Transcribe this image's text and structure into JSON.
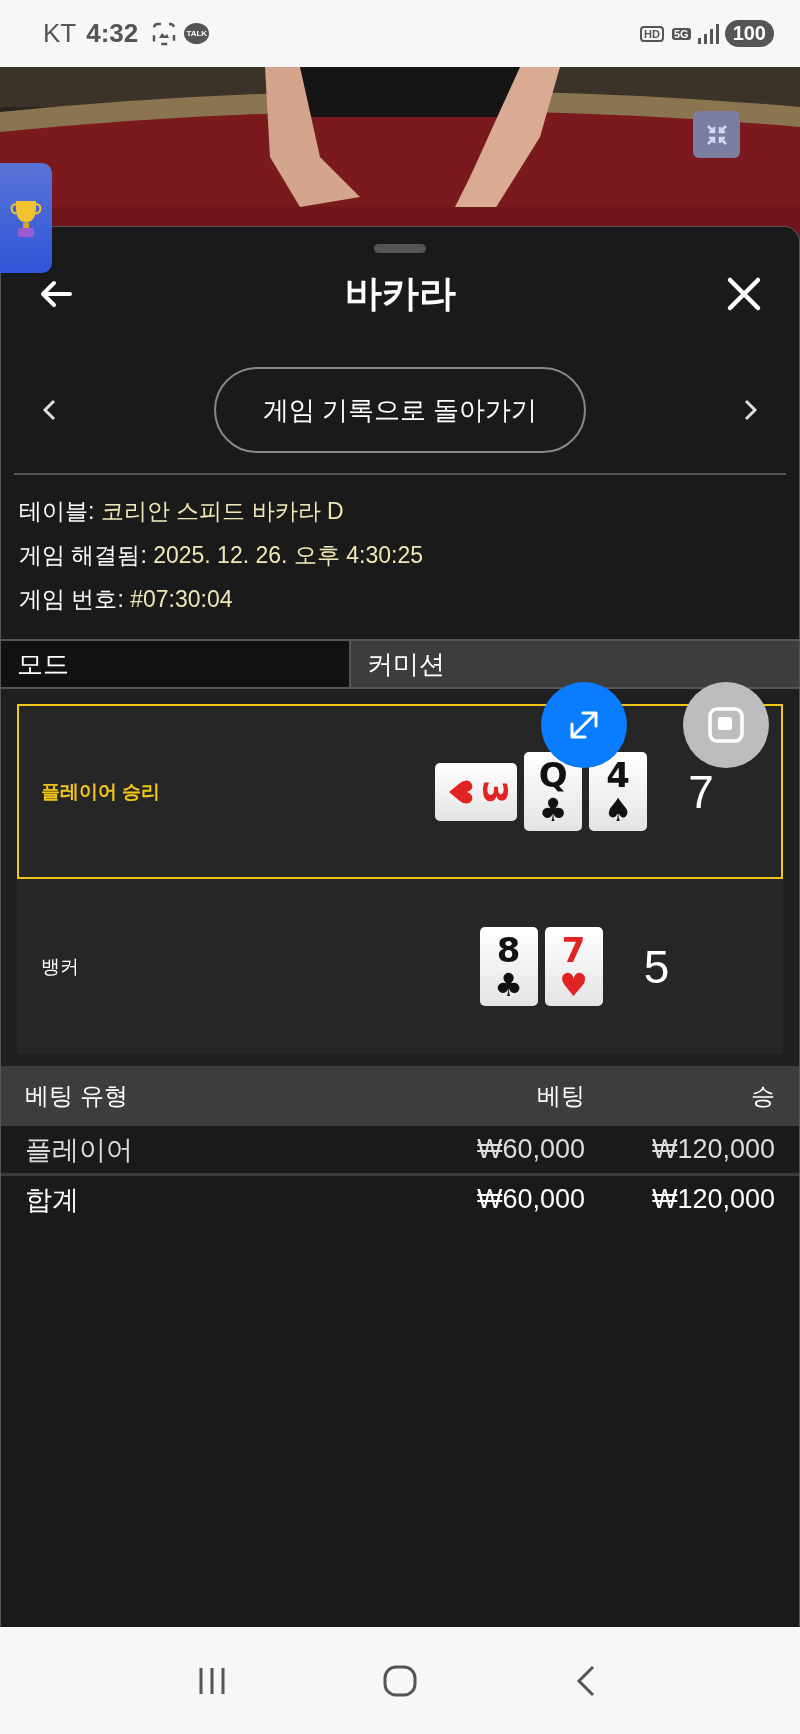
{
  "status_bar": {
    "carrier": "KT",
    "time": "4:32",
    "talk_badge": "TALK",
    "hd_badge": "HD",
    "network": "5G",
    "battery": "100"
  },
  "sheet": {
    "title": "바카라",
    "back_to_history": "게임 기록으로 돌아가기",
    "info": [
      {
        "label": "테이블: ",
        "value": "코리안 스피드 바카라 D"
      },
      {
        "label": "게임 해결됨: ",
        "value": "2025. 12. 26. 오후 4:30:25"
      },
      {
        "label": "게임 번호: ",
        "value": "#07:30:04"
      }
    ],
    "mode": {
      "label": "모드",
      "value": "커미션"
    },
    "hands": [
      {
        "label": "플레이어 승리",
        "winner": true,
        "score": "7",
        "cards": [
          {
            "rank": "3",
            "suit": "♥",
            "color": "#e02424",
            "kind": "sideways"
          },
          {
            "rank": "Q",
            "suit": "♣",
            "color": "#111111",
            "kind": "upright"
          },
          {
            "rank": "4",
            "suit": "♠",
            "color": "#111111",
            "kind": "upright"
          }
        ]
      },
      {
        "label": "뱅커",
        "winner": false,
        "score": "5",
        "cards": [
          {
            "rank": "8",
            "suit": "♣",
            "color": "#111111",
            "kind": "upright"
          },
          {
            "rank": "7",
            "suit": "♥",
            "color": "#e02424",
            "kind": "upright"
          }
        ]
      }
    ],
    "bets": {
      "columns": [
        "베팅 유형",
        "베팅",
        "승"
      ],
      "rows": [
        {
          "kind": "bet",
          "cells": [
            "플레이어",
            "₩60,000",
            "₩120,000"
          ]
        },
        {
          "kind": "total",
          "cells": [
            "합계",
            "₩60,000",
            "₩120,000"
          ]
        }
      ]
    }
  }
}
